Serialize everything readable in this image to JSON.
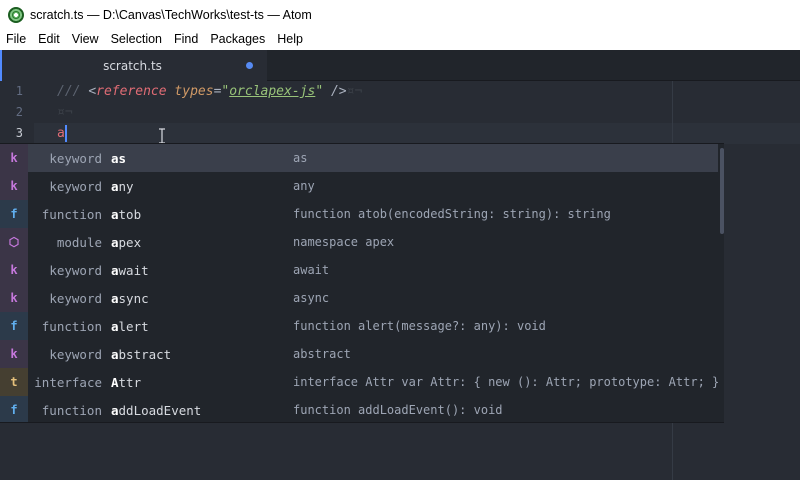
{
  "window": {
    "title": "scratch.ts — D:\\Canvas\\TechWorks\\test-ts — Atom"
  },
  "menu": [
    "File",
    "Edit",
    "View",
    "Selection",
    "Find",
    "Packages",
    "Help"
  ],
  "tabs": [
    {
      "label": "scratch.ts",
      "modified": true
    }
  ],
  "editor": {
    "lines": [
      {
        "number": "1",
        "comment": "/// ",
        "open": "<",
        "tag": "reference",
        "space": " ",
        "attr": "types",
        "eq": "=",
        "quote_open": "\"",
        "value": "orclapex-js",
        "quote_close": "\"",
        "close": " />",
        "eol": "¤¬"
      },
      {
        "number": "2",
        "eol": "¤¬"
      },
      {
        "number": "3",
        "text": "a"
      }
    ]
  },
  "autocomplete": {
    "items": [
      {
        "icon": "k",
        "icon_color": "#c678dd",
        "icon_bg": "#3b3547",
        "type": "keyword",
        "match": "as",
        "rest": "",
        "desc": "as",
        "selected": true
      },
      {
        "icon": "k",
        "icon_color": "#c678dd",
        "icon_bg": "#3b3547",
        "type": "keyword",
        "match": "a",
        "rest": "ny",
        "desc": "any"
      },
      {
        "icon": "f",
        "icon_color": "#61afef",
        "icon_bg": "#2c3a4a",
        "type": "function",
        "match": "a",
        "rest": "tob",
        "desc": "function atob(encodedString: string): string"
      },
      {
        "icon": "⬡",
        "icon_color": "#c678dd",
        "icon_bg": "#3b3547",
        "type": "module",
        "match": "a",
        "rest": "pex",
        "desc": "namespace apex"
      },
      {
        "icon": "k",
        "icon_color": "#c678dd",
        "icon_bg": "#3b3547",
        "type": "keyword",
        "match": "a",
        "rest": "wait",
        "desc": "await"
      },
      {
        "icon": "k",
        "icon_color": "#c678dd",
        "icon_bg": "#3b3547",
        "type": "keyword",
        "match": "a",
        "rest": "sync",
        "desc": "async"
      },
      {
        "icon": "f",
        "icon_color": "#61afef",
        "icon_bg": "#2c3a4a",
        "type": "function",
        "match": "a",
        "rest": "lert",
        "desc": "function alert(message?: any): void"
      },
      {
        "icon": "k",
        "icon_color": "#c678dd",
        "icon_bg": "#3b3547",
        "type": "keyword",
        "match": "a",
        "rest": "bstract",
        "desc": "abstract"
      },
      {
        "icon": "t",
        "icon_color": "#e5c07b",
        "icon_bg": "#453f31",
        "type": "interface",
        "match": "A",
        "rest": "ttr",
        "desc": "interface Attr var Attr: { new (): Attr; prototype: Attr; }"
      },
      {
        "icon": "f",
        "icon_color": "#61afef",
        "icon_bg": "#2c3a4a",
        "type": "function",
        "match": "a",
        "rest": "ddLoadEvent",
        "desc": "function addLoadEvent(): void"
      }
    ]
  }
}
